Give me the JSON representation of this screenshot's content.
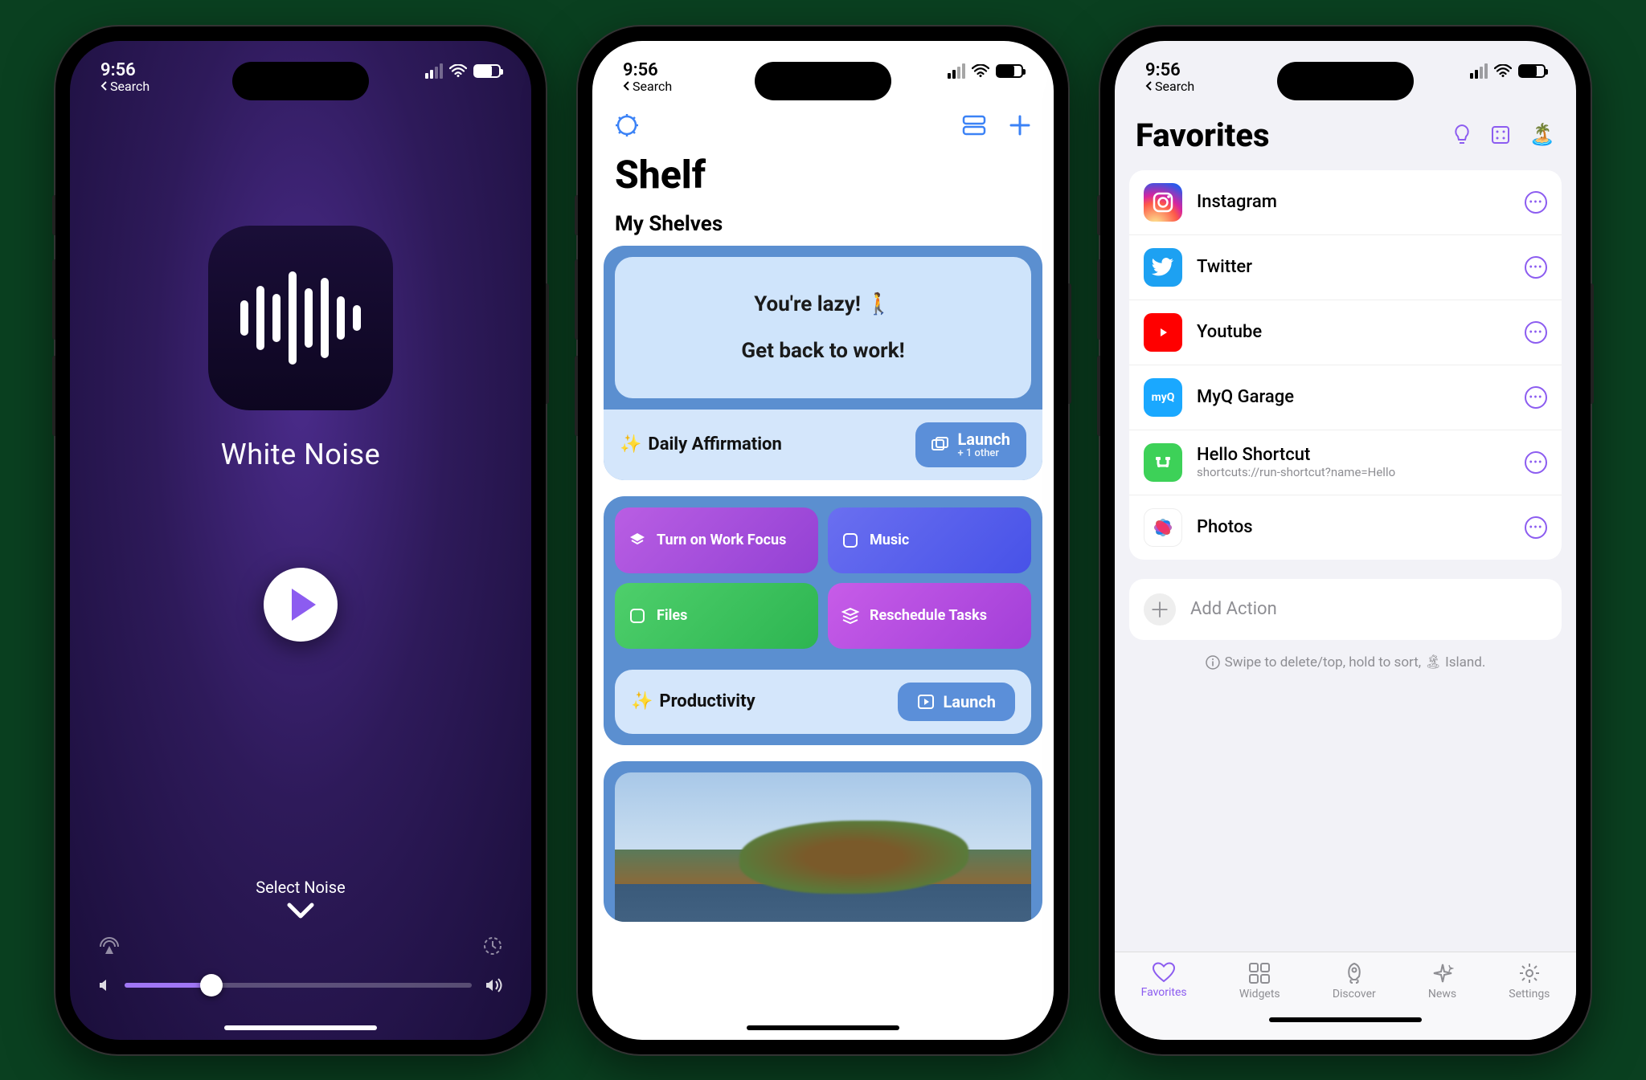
{
  "status": {
    "time": "9:56",
    "back_label": "Search"
  },
  "phone1": {
    "title": "White Noise",
    "select_label": "Select Noise"
  },
  "phone2": {
    "app_title": "Shelf",
    "section": "My Shelves",
    "affirmation_line1": "You're lazy! 🚶",
    "affirmation_line2": "Get back to work!",
    "shelf1_name": "Daily Affirmation",
    "shelf1_launch": "Launch",
    "shelf1_launch_sub": "+ 1 other",
    "tiles": {
      "focus": "Turn on Work Focus",
      "music": "Music",
      "files": "Files",
      "reschedule": "Reschedule Tasks"
    },
    "shelf2_name": "Productivity",
    "shelf2_launch": "Launch"
  },
  "phone3": {
    "title": "Favorites",
    "items": [
      {
        "name": "Instagram"
      },
      {
        "name": "Twitter"
      },
      {
        "name": "Youtube"
      },
      {
        "name": "MyQ Garage"
      },
      {
        "name": "Hello Shortcut",
        "sub": "shortcuts://run-shortcut?name=Hello"
      },
      {
        "name": "Photos"
      }
    ],
    "add_label": "Add Action",
    "hint": "Swipe to delete/top, hold to sort, 🏝 Island.",
    "tabs": {
      "favorites": "Favorites",
      "widgets": "Widgets",
      "discover": "Discover",
      "news": "News",
      "settings": "Settings"
    }
  }
}
